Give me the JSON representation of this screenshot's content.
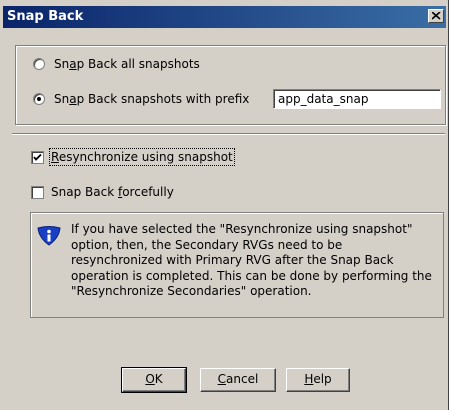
{
  "window": {
    "title": "Snap Back",
    "close_icon": "close-icon"
  },
  "options": {
    "snap_all": {
      "pre": "Sn",
      "u": "a",
      "post": "p Back all snapshots",
      "checked": false
    },
    "snap_prefix": {
      "pre": "Sn",
      "u": "a",
      "post": "p Back snapshots with prefix",
      "checked": true
    },
    "prefix_value": "app_data_snap"
  },
  "checks": {
    "resync": {
      "pre": "",
      "u": "R",
      "post": "esynchronize using snapshot",
      "checked": true
    },
    "force": {
      "pre": "Snap Back ",
      "u": "f",
      "post": "orcefully",
      "checked": false
    }
  },
  "info": {
    "icon": "info-shield-icon",
    "lines": [
      "If you have selected the \"Resynchronize using snapshot\"",
      "option, then, the Secondary RVGs need to be",
      "resynchronized with Primary RVG after the Snap Back",
      "operation is completed. This can be done by performing the",
      "\"Resynchronize Secondaries\" operation."
    ]
  },
  "buttons": {
    "ok": {
      "pre": "",
      "u": "O",
      "post": "K"
    },
    "cancel": {
      "pre": "",
      "u": "C",
      "post": "ancel"
    },
    "help": {
      "pre": "",
      "u": "H",
      "post": "elp"
    }
  }
}
